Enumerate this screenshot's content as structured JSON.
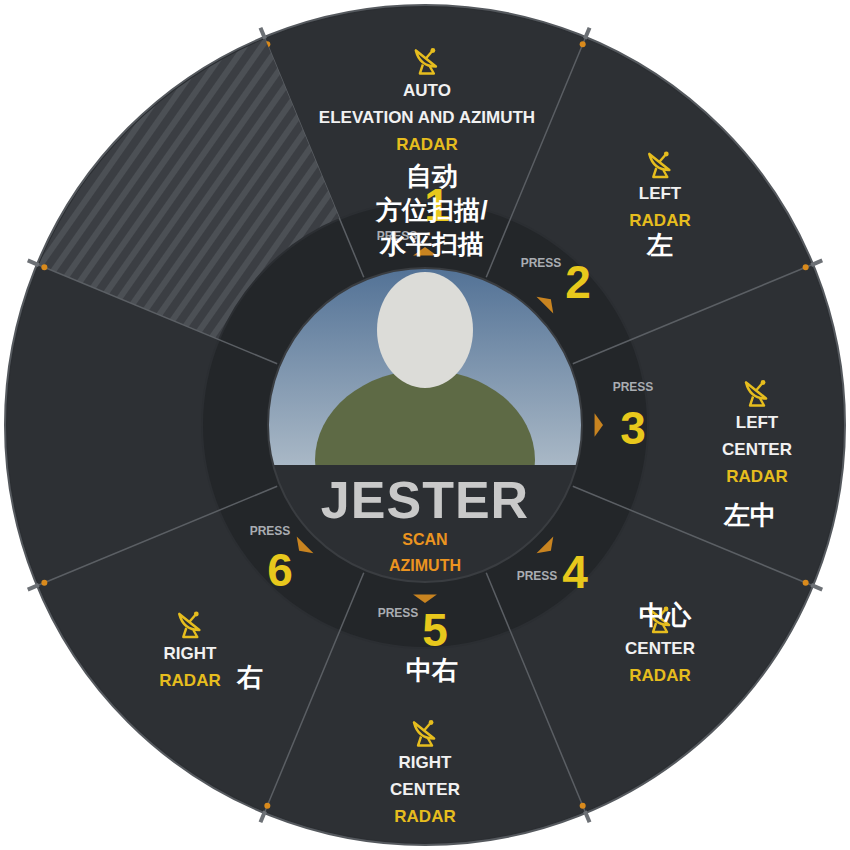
{
  "center": {
    "title": "JESTER",
    "mode": [
      "SCAN",
      "AZIMUTH"
    ]
  },
  "items": [
    {
      "kind": "option",
      "press_label": "PRESS",
      "press": "1",
      "lines": [
        "AUTO",
        "ELEVATION AND AZIMUTH"
      ],
      "tag": "RADAR",
      "note": [
        "自动",
        "方位扫描/",
        "水平扫描"
      ]
    },
    {
      "kind": "option",
      "press_label": "PRESS",
      "press": "2",
      "lines": [
        "LEFT"
      ],
      "tag": "RADAR",
      "note": [
        "左"
      ]
    },
    {
      "kind": "option",
      "press_label": "PRESS",
      "press": "3",
      "lines": [
        "LEFT",
        "CENTER"
      ],
      "tag": "RADAR",
      "note": [
        "左中"
      ]
    },
    {
      "kind": "option",
      "press_label": "PRESS",
      "press": "4",
      "lines": [
        "CENTER"
      ],
      "tag": "RADAR",
      "note": [
        "中心"
      ]
    },
    {
      "kind": "option",
      "press_label": "PRESS",
      "press": "5",
      "lines": [
        "RIGHT",
        "CENTER"
      ],
      "tag": "RADAR",
      "note": [
        "中右"
      ]
    },
    {
      "kind": "option",
      "press_label": "PRESS",
      "press": "6",
      "lines": [
        "RIGHT"
      ],
      "tag": "RADAR",
      "note": [
        "右"
      ]
    },
    {
      "kind": "empty"
    },
    {
      "kind": "hatched"
    }
  ]
}
